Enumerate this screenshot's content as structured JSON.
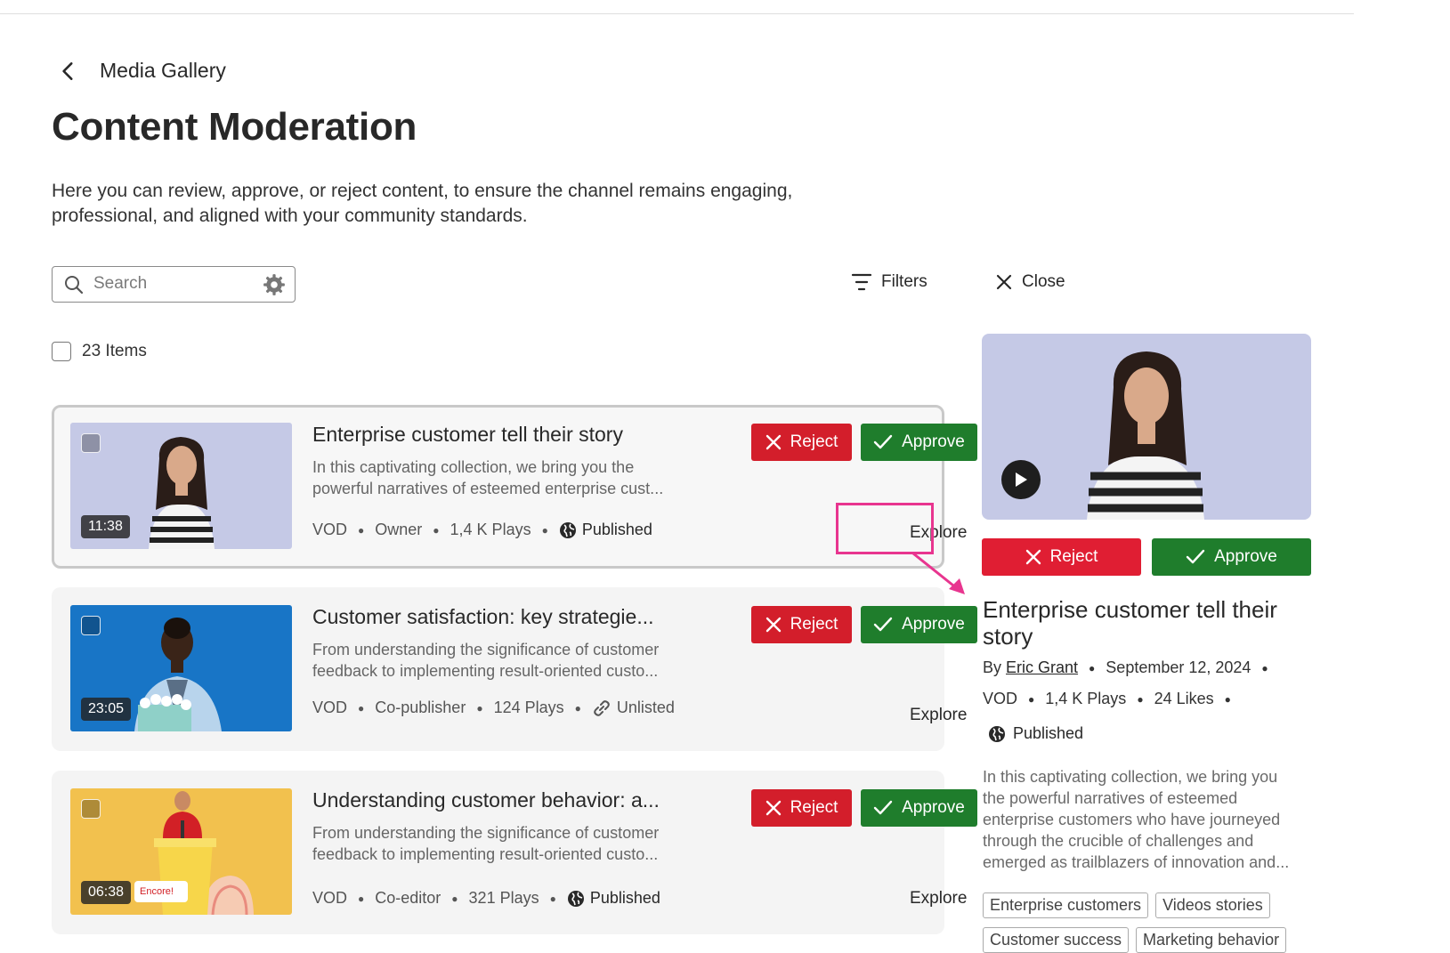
{
  "breadcrumb": {
    "back_label": "Media Gallery"
  },
  "page": {
    "title": "Content Moderation",
    "description": "Here you can review, approve, or reject content, to ensure the channel remains engaging, professional, and aligned with your community standards."
  },
  "toolbar": {
    "search_placeholder": "Search",
    "filters_label": "Filters",
    "close_label": "Close",
    "items_count_label": "23 Items"
  },
  "items": [
    {
      "title": "Enterprise customer tell their story",
      "description": "In this captivating collection, we bring you the powerful narratives of esteemed enterprise cust...",
      "duration": "11:38",
      "type": "VOD",
      "role": "Owner",
      "plays": "1,4 K Plays",
      "visibility": "Published",
      "reject_label": "Reject",
      "approve_label": "Approve",
      "explore_label": "Explore"
    },
    {
      "title": "Customer satisfaction: key strategie...",
      "description": "From understanding the significance of customer feedback to implementing result-oriented custo...",
      "duration": "23:05",
      "type": "VOD",
      "role": "Co-publisher",
      "plays": "124 Plays",
      "visibility": "Unlisted",
      "reject_label": "Reject",
      "approve_label": "Approve",
      "explore_label": "Explore"
    },
    {
      "title": "Understanding customer behavior: a...",
      "description": "From understanding the significance of customer feedback to implementing result-oriented custo...",
      "duration": "06:38",
      "thumb_caption": "Encore!",
      "type": "VOD",
      "role": "Co-editor",
      "plays": "321 Plays",
      "visibility": "Published",
      "reject_label": "Reject",
      "approve_label": "Approve",
      "explore_label": "Explore"
    }
  ],
  "detail": {
    "reject_label": "Reject",
    "approve_label": "Approve",
    "title": "Enterprise customer tell their story",
    "by_label": "By",
    "author": "Eric Grant",
    "date": "September 12, 2024",
    "type": "VOD",
    "plays": "1,4 K Plays",
    "likes": "24 Likes",
    "visibility": "Published",
    "description": "In this captivating collection, we bring you the powerful narratives of esteemed enterprise customers who have journeyed through the crucible of challenges and emerged as trailblazers of innovation and...",
    "tags": [
      "Enterprise customers",
      "Videos stories",
      "Customer success",
      "Marketing behavior"
    ]
  },
  "colors": {
    "reject": "#d31e2b",
    "approve": "#1f7d2c",
    "highlight": "#e8358f"
  }
}
